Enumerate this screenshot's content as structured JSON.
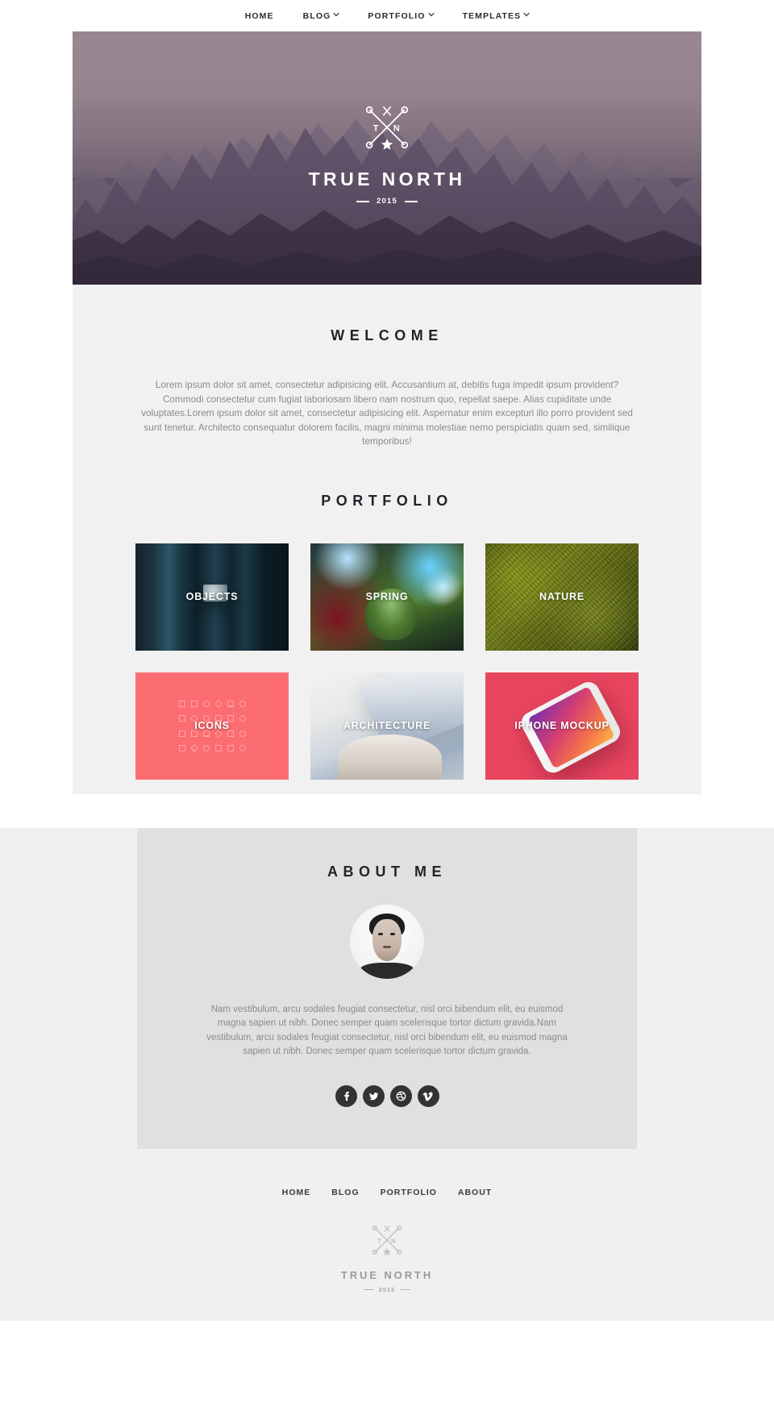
{
  "nav": {
    "items": [
      {
        "label": "HOME",
        "has_caret": false
      },
      {
        "label": "BLOG",
        "has_caret": true
      },
      {
        "label": "PORTFOLIO",
        "has_caret": true
      },
      {
        "label": "TEMPLATES",
        "has_caret": true
      }
    ]
  },
  "hero": {
    "brand": "TRUE NORTH",
    "year": "2015",
    "logo_letters": {
      "left": "T",
      "right": "N"
    }
  },
  "welcome": {
    "title": "WELCOME",
    "body": "Lorem ipsum dolor sit amet, consectetur adipisicing elit. Accusantium at, debitis fuga impedit ipsum provident? Commodi consectetur cum fugiat laboriosam libero nam nostrum quo, repellat saepe. Alias cupiditate unde voluptates.Lorem ipsum dolor sit amet, consectetur adipisicing elit. Aspernatur enim excepturi illo porro provident sed sunt tenetur. Architecto consequatur dolorem facilis, magni minima molestiae nemo perspiciatis quam sed, similique temporibus!"
  },
  "portfolio": {
    "title": "PORTFOLIO",
    "tiles": [
      {
        "label": "OBJECTS",
        "art": "objects"
      },
      {
        "label": "SPRING",
        "art": "spring"
      },
      {
        "label": "NATURE",
        "art": "nature"
      },
      {
        "label": "ICONS",
        "art": "icons"
      },
      {
        "label": "ARCHITECTURE",
        "art": "arch"
      },
      {
        "label": "IPHONE MOCKUP",
        "art": "iphone"
      }
    ]
  },
  "about": {
    "title": "ABOUT ME",
    "body": "Nam vestibulum, arcu sodales feugiat consectetur, nisl orci bibendum elit, eu euismod magna sapien ut nibh. Donec semper quam scelerisque tortor dictum gravida.Nam vestibulum, arcu sodales feugiat consectetur, nisl orci bibendum elit, eu euismod magna sapien ut nibh. Donec semper quam scelerisque tortor dictum gravida.",
    "socials": [
      {
        "name": "facebook",
        "icon": "facebook-icon"
      },
      {
        "name": "twitter",
        "icon": "twitter-icon"
      },
      {
        "name": "dribbble",
        "icon": "dribbble-icon"
      },
      {
        "name": "vimeo",
        "icon": "vimeo-icon"
      }
    ]
  },
  "footer": {
    "links": [
      "HOME",
      "BLOG",
      "PORTFOLIO",
      "ABOUT"
    ],
    "brand": "TRUE NORTH",
    "year": "2015",
    "logo_letters": {
      "left": "T",
      "right": "N"
    }
  },
  "colors": {
    "page_bg": "#ffffff",
    "section_bg": "#f1f1f1",
    "footer_bg": "#f0f0f0",
    "card_bg": "#e0e0e0",
    "text_dark": "#23232b",
    "text_muted": "#8b8b8b",
    "accent_coral": "#fc6d72",
    "accent_red": "#e8455f",
    "social_bg": "#333333"
  }
}
